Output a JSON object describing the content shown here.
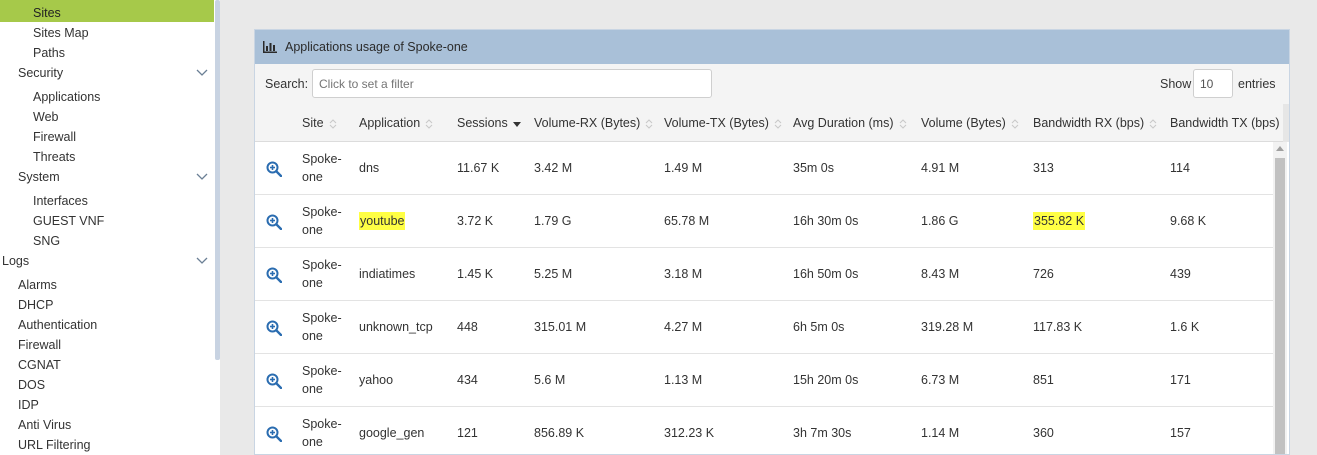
{
  "sidebar": {
    "items": [
      {
        "label": "Sites",
        "level": 2,
        "active": true
      },
      {
        "label": "Sites Map",
        "level": 2
      },
      {
        "label": "Paths",
        "level": 2
      },
      {
        "label": "Security",
        "level": 1,
        "expandable": true
      },
      {
        "label": "Applications",
        "level": 2
      },
      {
        "label": "Web",
        "level": 2
      },
      {
        "label": "Firewall",
        "level": 2
      },
      {
        "label": "Threats",
        "level": 2
      },
      {
        "label": "System",
        "level": 1,
        "expandable": true
      },
      {
        "label": "Interfaces",
        "level": 2
      },
      {
        "label": "GUEST VNF",
        "level": 2
      },
      {
        "label": "SNG",
        "level": 2
      },
      {
        "label": "Logs",
        "level": 0,
        "expandable": true
      },
      {
        "label": "Alarms",
        "level": 1
      },
      {
        "label": "DHCP",
        "level": 1
      },
      {
        "label": "Authentication",
        "level": 1
      },
      {
        "label": "Firewall",
        "level": 1
      },
      {
        "label": "CGNAT",
        "level": 1
      },
      {
        "label": "DOS",
        "level": 1
      },
      {
        "label": "IDP",
        "level": 1
      },
      {
        "label": "Anti Virus",
        "level": 1
      },
      {
        "label": "URL Filtering",
        "level": 1
      }
    ]
  },
  "panel": {
    "title": "Applications usage of Spoke-one",
    "title_icon": "bar-chart-icon",
    "search_label": "Search:",
    "search_placeholder": "Click to set a filter",
    "show_label": "Show",
    "entries_value": "10",
    "entries_label": "entries"
  },
  "table": {
    "columns": [
      "Site",
      "Application",
      "Sessions",
      "Volume-RX (Bytes)",
      "Volume-TX (Bytes)",
      "Avg Duration (ms)",
      "Volume (Bytes)",
      "Bandwidth RX (bps)",
      "Bandwidth TX (bps)"
    ],
    "sorted_column": "Sessions",
    "sort_direction": "desc",
    "rows": [
      {
        "site": "Spoke-one",
        "application": "dns",
        "sessions": "11.67 K",
        "volume_rx": "3.42 M",
        "volume_tx": "1.49 M",
        "avg_duration": "35m 0s",
        "volume": "4.91 M",
        "bandwidth_rx": "313",
        "bandwidth_tx": "114"
      },
      {
        "site": "Spoke-one",
        "application": "youtube",
        "sessions": "3.72 K",
        "volume_rx": "1.79 G",
        "volume_tx": "65.78 M",
        "avg_duration": "16h 30m 0s",
        "volume": "1.86 G",
        "bandwidth_rx": "355.82 K",
        "bandwidth_tx": "9.68 K",
        "highlight": [
          "application",
          "bandwidth_rx"
        ]
      },
      {
        "site": "Spoke-one",
        "application": "indiatimes",
        "sessions": "1.45 K",
        "volume_rx": "5.25 M",
        "volume_tx": "3.18 M",
        "avg_duration": "16h 50m 0s",
        "volume": "8.43 M",
        "bandwidth_rx": "726",
        "bandwidth_tx": "439"
      },
      {
        "site": "Spoke-one",
        "application": "unknown_tcp",
        "sessions": "448",
        "volume_rx": "315.01 M",
        "volume_tx": "4.27 M",
        "avg_duration": "6h 5m 0s",
        "volume": "319.28 M",
        "bandwidth_rx": "117.83 K",
        "bandwidth_tx": "1.6 K"
      },
      {
        "site": "Spoke-one",
        "application": "yahoo",
        "sessions": "434",
        "volume_rx": "5.6 M",
        "volume_tx": "1.13 M",
        "avg_duration": "15h 20m 0s",
        "volume": "6.73 M",
        "bandwidth_rx": "851",
        "bandwidth_tx": "171"
      },
      {
        "site": "Spoke-one",
        "application": "google_gen",
        "sessions": "121",
        "volume_rx": "856.89 K",
        "volume_tx": "312.23 K",
        "avg_duration": "3h 7m 30s",
        "volume": "1.14 M",
        "bandwidth_rx": "360",
        "bandwidth_tx": "157"
      }
    ]
  },
  "colors": {
    "active_item": "#a6c94a",
    "panel_header": "#a9c0d8",
    "highlight": "#ffff44",
    "zoom_icon": "#2a6cb0"
  }
}
